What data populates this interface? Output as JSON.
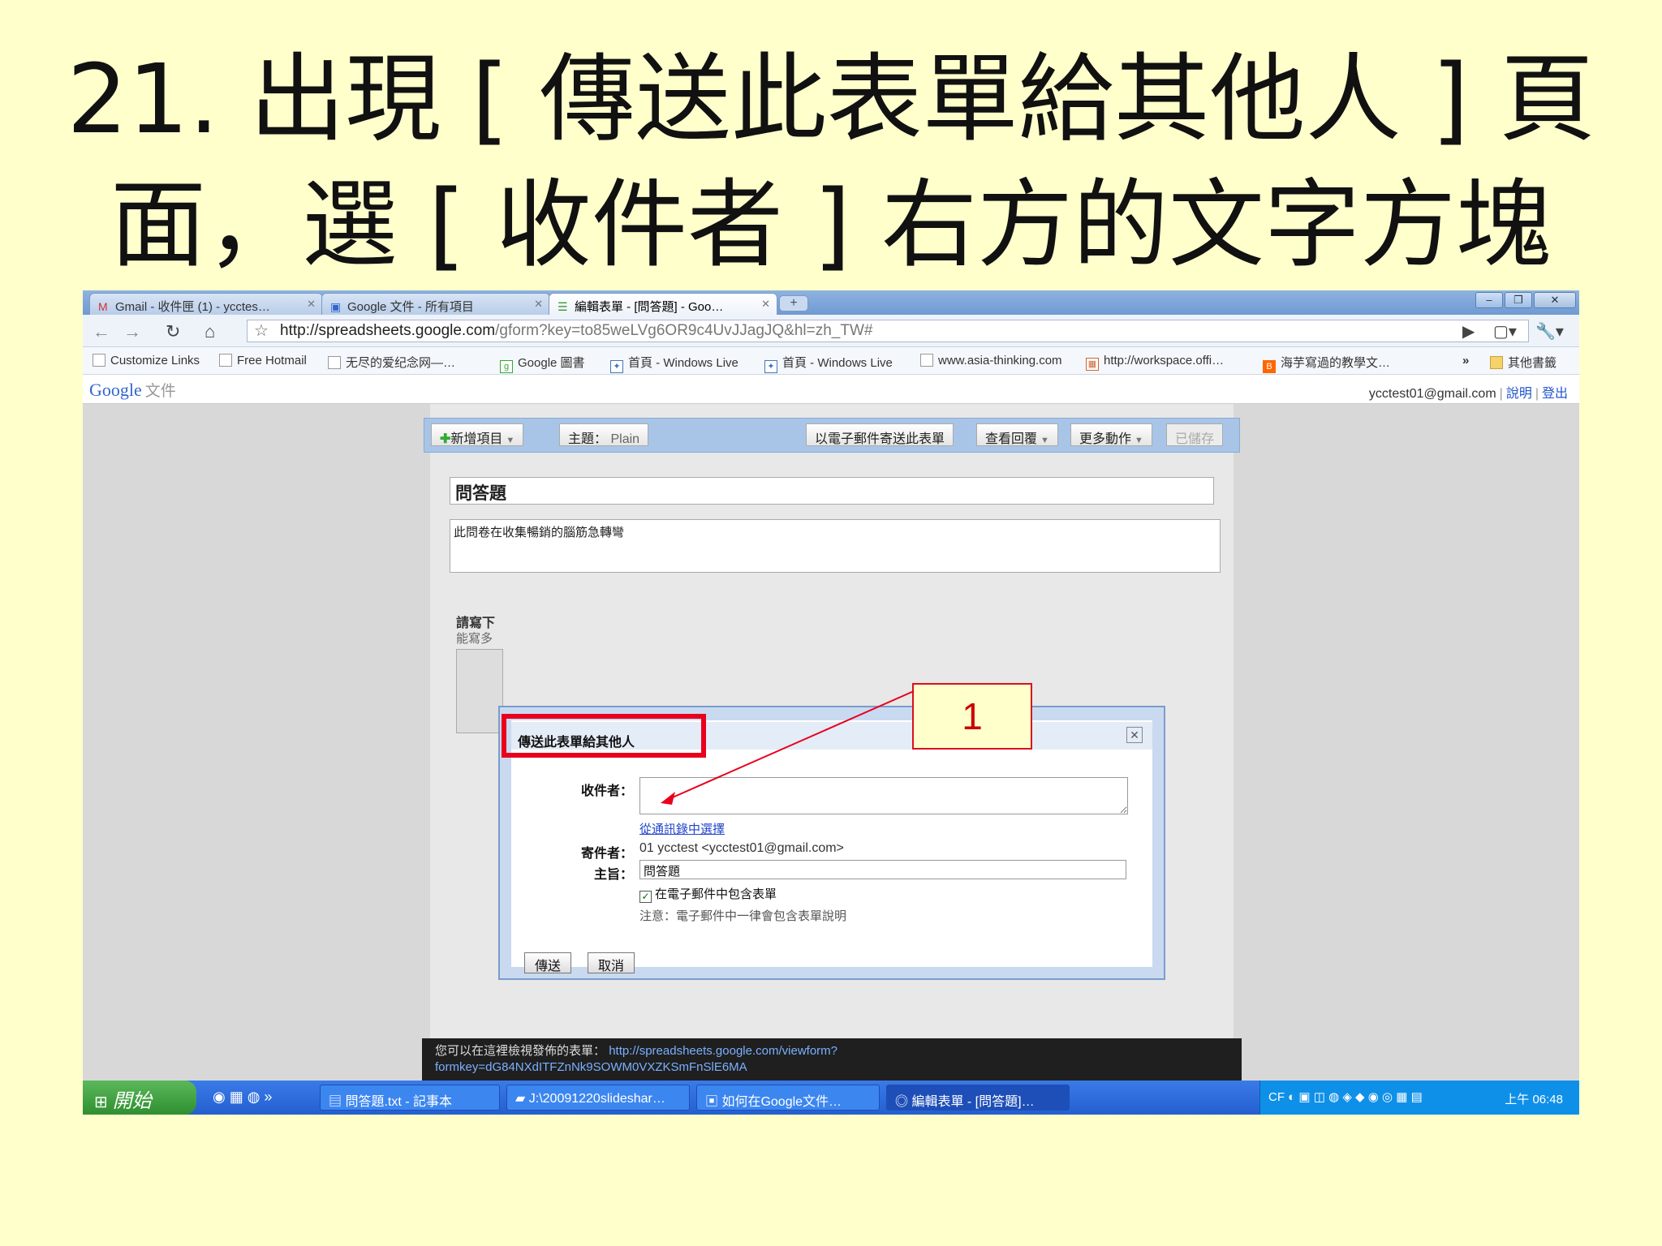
{
  "slide": {
    "title_line1": "21. 出現 [ 傳送此表單給其他人 ] 頁",
    "title_line2": "面，選 [ 收件者 ] 右方的文字方塊"
  },
  "browser": {
    "tabs": [
      {
        "label": "Gmail - 收件匣 (1) - ycctes…",
        "icon": "gmail-icon"
      },
      {
        "label": "Google 文件 - 所有項目",
        "icon": "docs-icon"
      },
      {
        "label": "編輯表單 - [問答題] - Goo…",
        "icon": "form-icon",
        "active": true
      }
    ],
    "url_main": "http://spreadsheets.google.com",
    "url_rest": "/gform?key=to85weLVg6OR9c4UvJJagJQ&hl=zh_TW#",
    "bookmarks": [
      "Customize Links",
      "Free Hotmail",
      "无尽的爱纪念网—…",
      "Google 圖書",
      "首頁 - Windows Live",
      "首頁 - Windows Live",
      "www.asia-thinking.com",
      "http://workspace.offi…",
      "海芋寫過的教學文…"
    ],
    "other_bookmarks": "其他書籤",
    "more_bookmarks": "»"
  },
  "google_header": {
    "logo": "Google",
    "product": "文件",
    "user_email": "ycctest01@gmail.com",
    "help": "說明",
    "logout": "登出"
  },
  "toolbar": {
    "add_item": "新增項目",
    "theme_label": "主題：",
    "theme_value": "Plain",
    "email_form": "以電子郵件寄送此表單",
    "view_responses": "查看回覆",
    "more_actions": "更多動作",
    "saved": "已儲存"
  },
  "form": {
    "title": "問答題",
    "description": "此問卷在收集暢銷的腦筋急轉彎",
    "question_label": "請寫下",
    "question_hint": "能寫多"
  },
  "dialog": {
    "title": "傳送此表單給其他人",
    "to_label": "收件者：",
    "pick_contacts": "從通訊錄中選擇",
    "from_label": "寄件者：",
    "from_value": "01 ycctest <ycctest01@gmail.com>",
    "subject_label": "主旨：",
    "subject_value": "問答題",
    "include_form": "在電子郵件中包含表單",
    "note": "注意：電子郵件中一律會包含表單說明",
    "send": "傳送",
    "cancel": "取消",
    "close": "✕"
  },
  "callout": {
    "number": "1",
    "color": "#e8001c"
  },
  "status_bar": {
    "text": "您可以在這裡檢視發佈的表單：",
    "url_line1": "http://spreadsheets.google.com/viewform?",
    "url_line2": "formkey=dG84NXdITFZnNk9SOWM0VXZKSmFnSlE6MA"
  },
  "taskbar": {
    "start": "開始",
    "tasks": [
      "問答題.txt - 記事本",
      "J:\\20091220slideshar…",
      "如何在Google文件…",
      "編輯表單 - [問答題]…"
    ],
    "clock": "上午 06:48",
    "tray_label": "CF"
  }
}
